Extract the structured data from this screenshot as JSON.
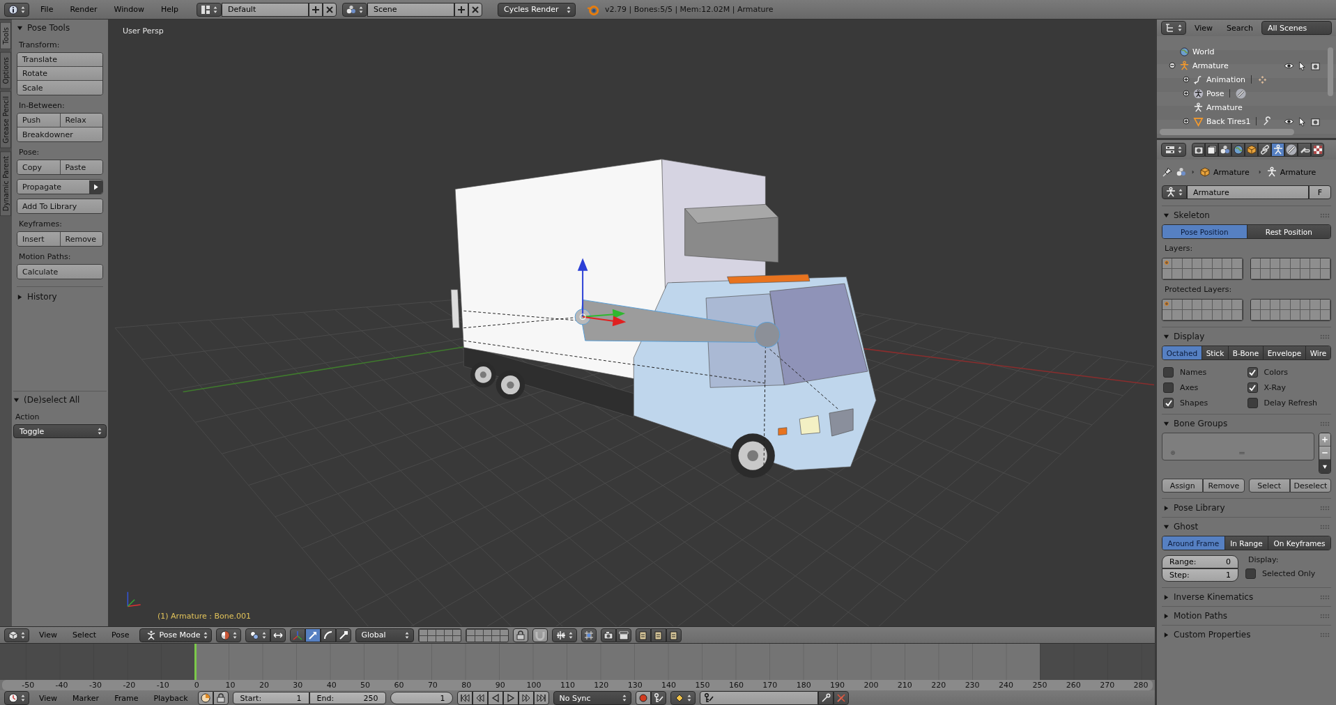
{
  "top_bar": {
    "menus": [
      "File",
      "Render",
      "Window",
      "Help"
    ],
    "screen_layout": "Default",
    "scene": "Scene",
    "render_engine": "Cycles Render",
    "stats": "v2.79 | Bones:5/5 | Mem:12.02M | Armature"
  },
  "tool_tabs": [
    {
      "label": "Tools",
      "selected": true
    },
    {
      "label": "Options",
      "selected": false
    },
    {
      "label": "Grease Pencil",
      "selected": false
    },
    {
      "label": "Dynamic Parent",
      "selected": false
    }
  ],
  "tool_panel": {
    "title": "Pose Tools",
    "expanded": true,
    "groups": [
      {
        "label": "Transform:",
        "blocks": [
          [
            [
              {
                "label": "Translate",
                "kind": "button"
              }
            ],
            [
              {
                "label": "Rotate",
                "kind": "button"
              }
            ],
            [
              {
                "label": "Scale",
                "kind": "button"
              }
            ]
          ]
        ]
      },
      {
        "label": "In-Between:",
        "blocks": [
          [
            [
              {
                "label": "Push",
                "kind": "button"
              },
              {
                "label": "Relax",
                "kind": "button"
              }
            ],
            [
              {
                "label": "Breakdowner",
                "kind": "button"
              }
            ]
          ]
        ]
      },
      {
        "label": "Pose:",
        "blocks": [
          [
            [
              {
                "label": "Copy",
                "kind": "button"
              },
              {
                "label": "Paste",
                "kind": "button"
              }
            ]
          ],
          [
            [
              {
                "label": "Propagate",
                "kind": "menu"
              }
            ]
          ],
          [
            [
              {
                "label": "Add To Library",
                "kind": "button"
              }
            ]
          ]
        ]
      },
      {
        "label": "Keyframes:",
        "blocks": [
          [
            [
              {
                "label": "Insert",
                "kind": "button"
              },
              {
                "label": "Remove",
                "kind": "button"
              }
            ]
          ]
        ]
      },
      {
        "label": "Motion Paths:",
        "blocks": [
          [
            [
              {
                "label": "Calculate",
                "kind": "button"
              }
            ]
          ]
        ]
      }
    ],
    "sections": [
      {
        "title": "History",
        "expanded": false
      }
    ]
  },
  "last_operator": {
    "title": "(De)select All",
    "expanded": true,
    "field_label": "Action",
    "value": "Toggle"
  },
  "viewport": {
    "view_name": "User Persp",
    "status": "(1) Armature : Bone.001"
  },
  "viewport_header": {
    "menus": [
      "View",
      "Select",
      "Pose"
    ],
    "mode": "Pose Mode",
    "transform_orientation": "Global",
    "manipulators": [
      {
        "kind": "translate",
        "selected": true
      },
      {
        "kind": "rotate",
        "selected": false
      },
      {
        "kind": "scale",
        "selected": false
      }
    ]
  },
  "timeline": {
    "ruler": [
      "-50",
      "-40",
      "-30",
      "-20",
      "-10",
      "0",
      "10",
      "20",
      "30",
      "40",
      "50",
      "60",
      "70",
      "80",
      "90",
      "100",
      "110",
      "120",
      "130",
      "140",
      "150",
      "160",
      "170",
      "180",
      "190",
      "200",
      "210",
      "220",
      "230",
      "240",
      "250",
      "260",
      "270",
      "280"
    ]
  },
  "timeline_header": {
    "menus": [
      "View",
      "Marker",
      "Frame",
      "Playback"
    ],
    "start_label": "Start:",
    "start": "1",
    "end_label": "End:",
    "end": "250",
    "current_frame": "1",
    "sync": "No Sync"
  },
  "outliner": {
    "menus": [
      "View",
      "Search"
    ],
    "filter": "All Scenes",
    "items": [
      {
        "label": "World",
        "kind": "world"
      },
      {
        "label": "Armature",
        "kind": "armature_object",
        "expanded": true,
        "children": [
          {
            "label": "Animation",
            "kind": "animation",
            "expanded": false
          },
          {
            "label": "Pose",
            "kind": "pose",
            "expanded": false
          },
          {
            "label": "Armature",
            "kind": "armature_data"
          },
          {
            "label": "Back Tires1",
            "kind": "mesh",
            "expanded": false
          }
        ]
      }
    ]
  },
  "properties": {
    "context_tabs": [
      {
        "kind": "render",
        "selected": false
      },
      {
        "kind": "render_layers",
        "selected": false
      },
      {
        "kind": "scene",
        "selected": false
      },
      {
        "kind": "world",
        "selected": false
      },
      {
        "kind": "object",
        "selected": false
      },
      {
        "kind": "constraints",
        "selected": false
      },
      {
        "kind": "armature_data",
        "selected": true
      },
      {
        "kind": "bone",
        "selected": false
      },
      {
        "kind": "bone_constraints",
        "selected": false
      },
      {
        "kind": "texture",
        "selected": false
      }
    ],
    "breadcrumb": [
      "Armature",
      "Armature"
    ],
    "datablock": {
      "name": "Armature",
      "fake_user_label": "F"
    },
    "panels": [
      {
        "kind": "skeleton",
        "title": "Skeleton",
        "expanded": true,
        "positions": [
          {
            "label": "Pose Position",
            "selected": true
          },
          {
            "label": "Rest Position",
            "selected": false
          }
        ],
        "layers_label": "Layers:",
        "layers": [
          {
            "used": true
          },
          {
            "used": false
          },
          {
            "used": false
          },
          {
            "used": false
          },
          {
            "used": false
          },
          {
            "used": false
          },
          {
            "used": false
          },
          {
            "used": false
          },
          {
            "used": false
          },
          {
            "used": false
          },
          {
            "used": false
          },
          {
            "used": false
          },
          {
            "used": false
          },
          {
            "used": false
          },
          {
            "used": false
          },
          {
            "used": false
          },
          {
            "used": false
          },
          {
            "used": false
          },
          {
            "used": false
          },
          {
            "used": false
          },
          {
            "used": false
          },
          {
            "used": false
          },
          {
            "used": false
          },
          {
            "used": false
          },
          {
            "used": false
          },
          {
            "used": false
          },
          {
            "used": false
          },
          {
            "used": false
          },
          {
            "used": false
          },
          {
            "used": false
          },
          {
            "used": false
          },
          {
            "used": false
          }
        ],
        "protected_label": "Protected Layers:",
        "protected_layers": [
          {
            "used": true
          },
          {
            "used": false
          },
          {
            "used": false
          },
          {
            "used": false
          },
          {
            "used": false
          },
          {
            "used": false
          },
          {
            "used": false
          },
          {
            "used": false
          },
          {
            "used": false
          },
          {
            "used": false
          },
          {
            "used": false
          },
          {
            "used": false
          },
          {
            "used": false
          },
          {
            "used": false
          },
          {
            "used": false
          },
          {
            "used": false
          },
          {
            "used": false
          },
          {
            "used": false
          },
          {
            "used": false
          },
          {
            "used": false
          },
          {
            "used": false
          },
          {
            "used": false
          },
          {
            "used": false
          },
          {
            "used": false
          },
          {
            "used": false
          },
          {
            "used": false
          },
          {
            "used": false
          },
          {
            "used": false
          },
          {
            "used": false
          },
          {
            "used": false
          },
          {
            "used": false
          },
          {
            "used": false
          }
        ]
      },
      {
        "kind": "display",
        "title": "Display",
        "expanded": true,
        "draw_types": [
          {
            "label": "Octahed",
            "selected": true
          },
          {
            "label": "Stick",
            "selected": false
          },
          {
            "label": "B-Bone",
            "selected": false
          },
          {
            "label": "Envelope",
            "selected": false
          },
          {
            "label": "Wire",
            "selected": false
          }
        ],
        "options": [
          {
            "label": "Names",
            "checked": false
          },
          {
            "label": "Colors",
            "checked": true
          },
          {
            "label": "Axes",
            "checked": false
          },
          {
            "label": "X-Ray",
            "checked": true
          },
          {
            "label": "Shapes",
            "checked": true
          },
          {
            "label": "Delay Refresh",
            "checked": false
          }
        ]
      },
      {
        "kind": "bone_groups",
        "title": "Bone Groups",
        "expanded": true,
        "buttons": [
          "Assign",
          "Remove",
          "Select",
          "Deselect"
        ]
      },
      {
        "title": "Pose Library",
        "expanded": false
      },
      {
        "kind": "ghost",
        "title": "Ghost",
        "expanded": true,
        "types": [
          {
            "label": "Around Frame",
            "selected": true
          },
          {
            "label": "In Range",
            "selected": false
          },
          {
            "label": "On Keyframes",
            "selected": false
          }
        ],
        "fields": [
          {
            "label": "Range:",
            "value": "0"
          },
          {
            "label": "Step:",
            "value": "1"
          }
        ],
        "display_label": "Display:",
        "options": [
          {
            "label": "Selected Only",
            "checked": false
          }
        ]
      },
      {
        "title": "Inverse Kinematics",
        "expanded": false
      },
      {
        "title": "Motion Paths",
        "expanded": false
      },
      {
        "title": "Custom Properties",
        "expanded": false
      }
    ]
  }
}
